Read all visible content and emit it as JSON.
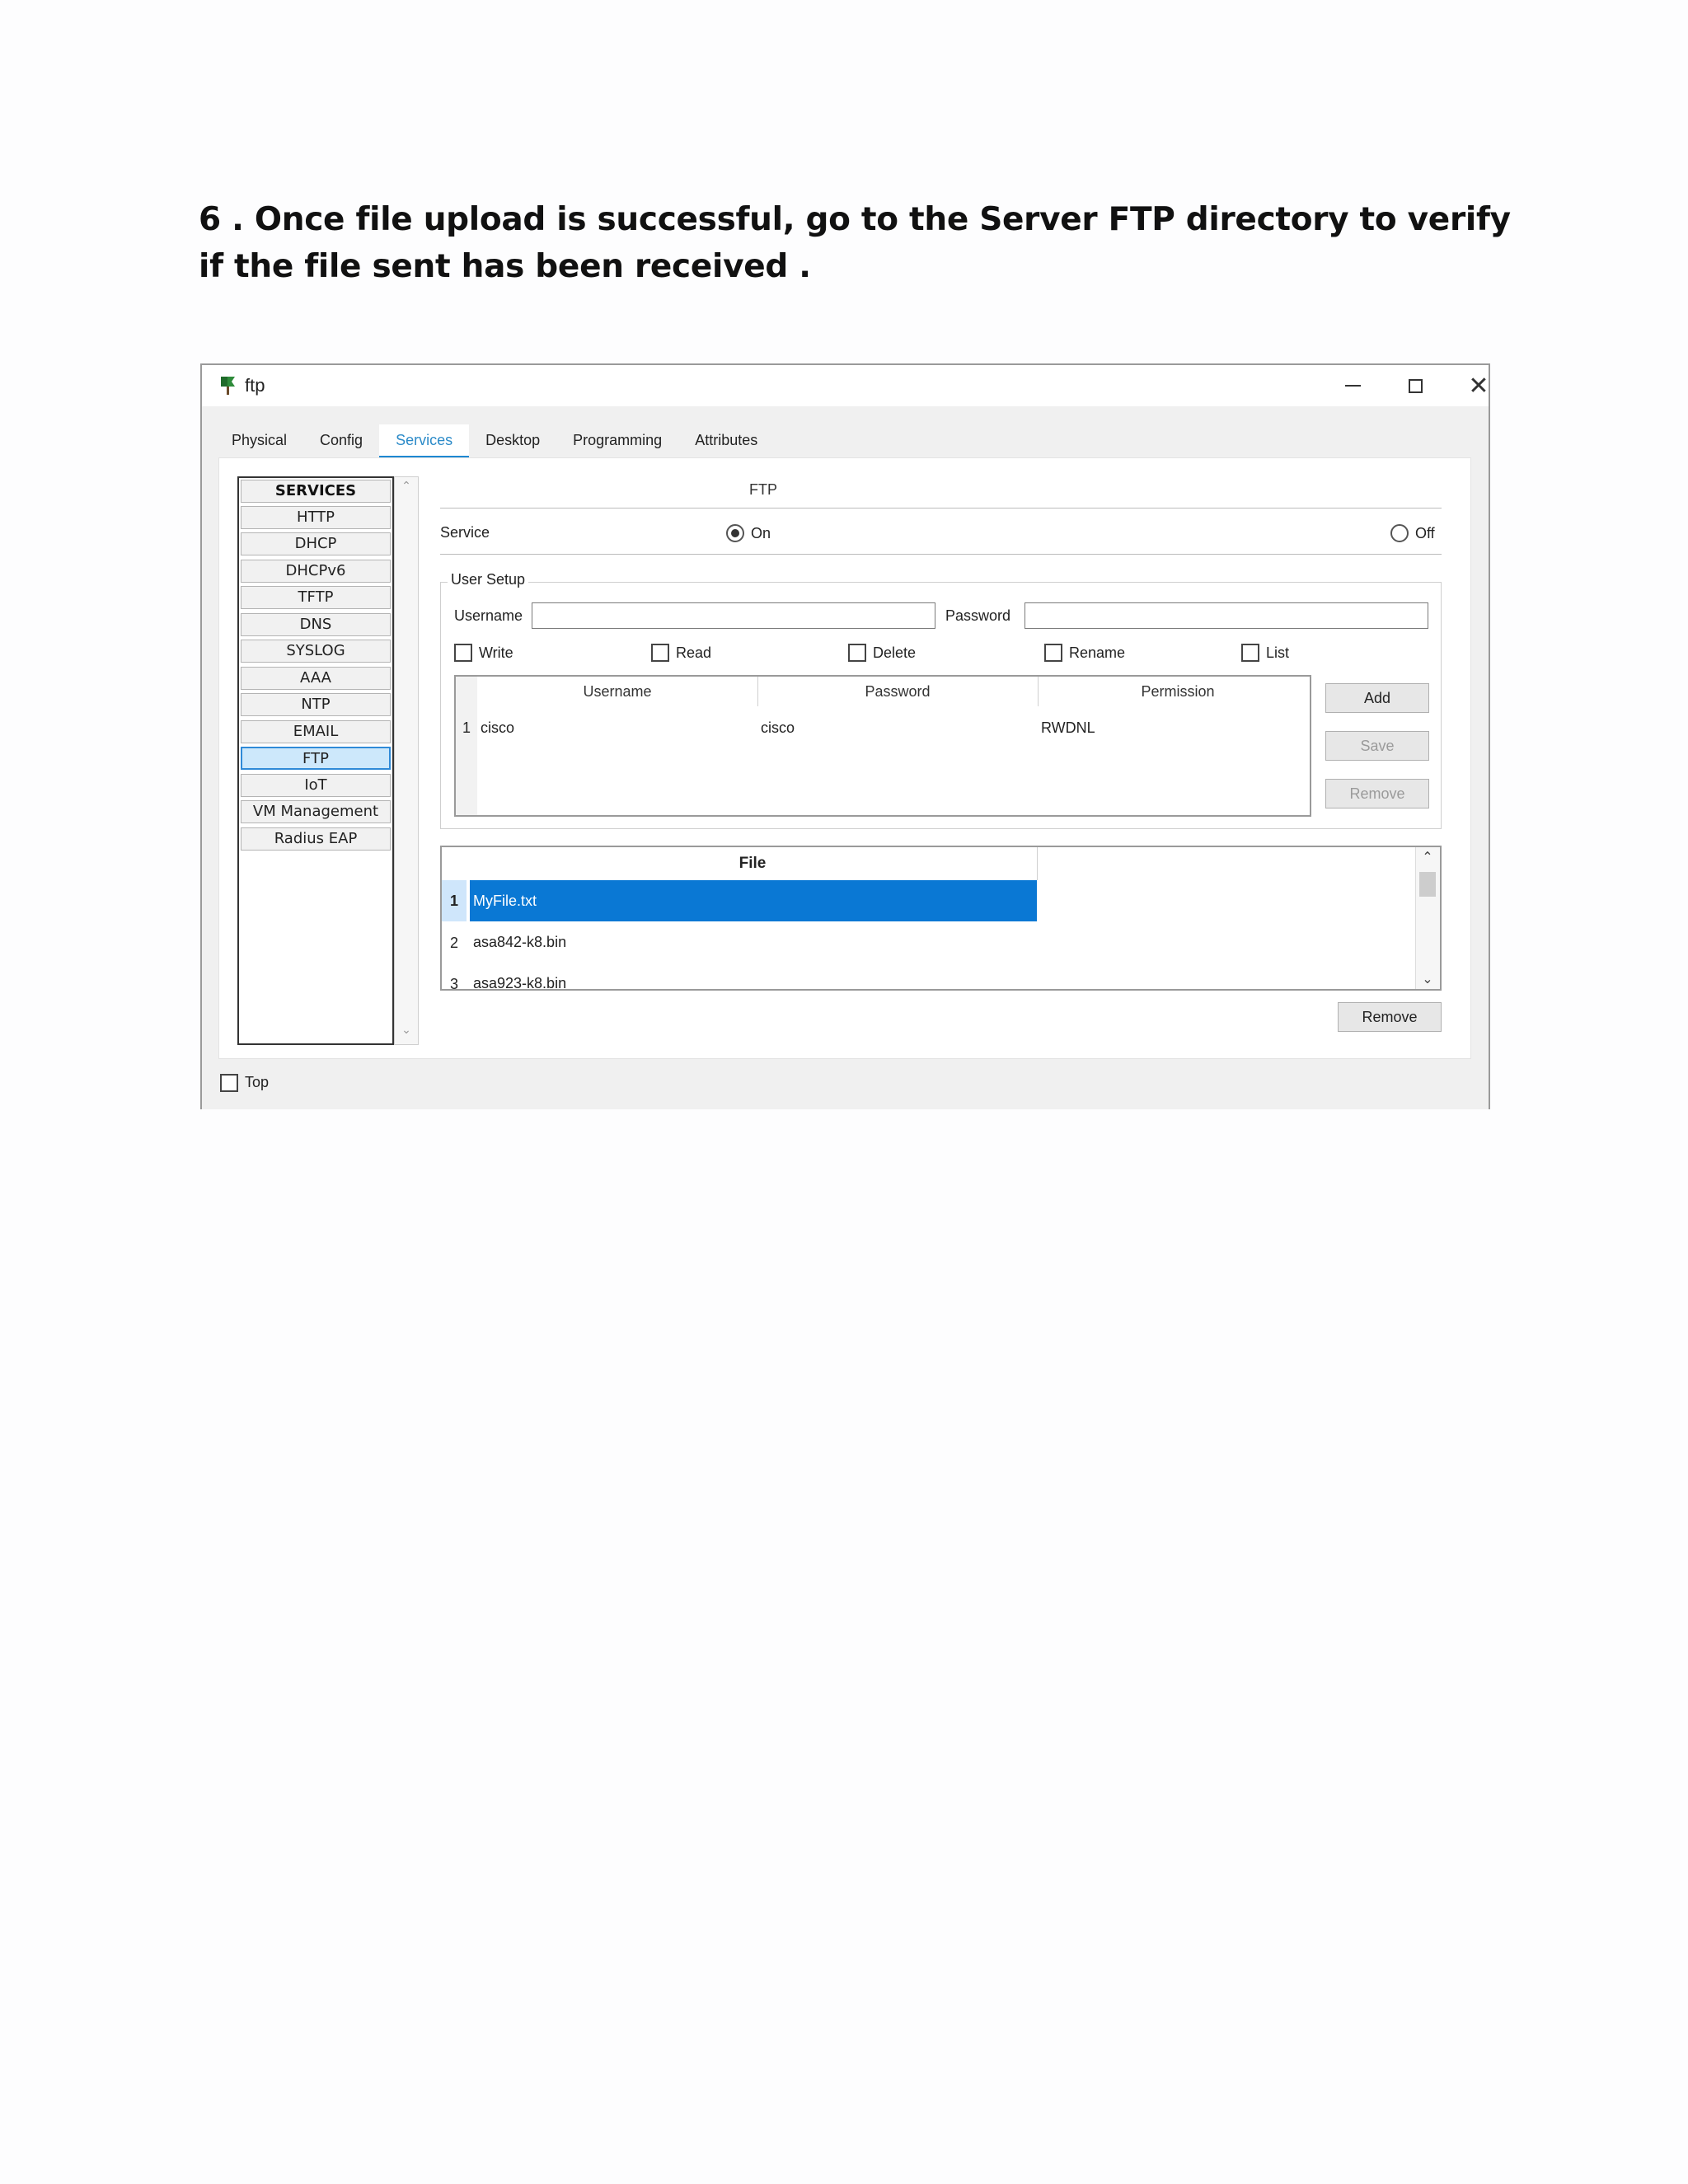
{
  "step_text": "6  . Once file upload is successful, go to the Server FTP directory to verify if the file sent has been received .",
  "window": {
    "title": "ftp",
    "minimize_icon": "minimize-icon",
    "maximize_icon": "maximize-icon",
    "close_icon": "close-icon"
  },
  "tabs": [
    {
      "label": "Physical",
      "active": false
    },
    {
      "label": "Config",
      "active": false
    },
    {
      "label": "Services",
      "active": true
    },
    {
      "label": "Desktop",
      "active": false
    },
    {
      "label": "Programming",
      "active": false
    },
    {
      "label": "Attributes",
      "active": false
    }
  ],
  "services": {
    "header": "SERVICES",
    "items": [
      "HTTP",
      "DHCP",
      "DHCPv6",
      "TFTP",
      "DNS",
      "SYSLOG",
      "AAA",
      "NTP",
      "EMAIL",
      "FTP",
      "IoT",
      "VM Management",
      "Radius EAP"
    ],
    "selected": "FTP"
  },
  "ftp": {
    "title": "FTP",
    "service_label": "Service",
    "on_label": "On",
    "off_label": "Off",
    "service_state": "On",
    "user_setup": {
      "legend": "User Setup",
      "username_label": "Username",
      "username_value": "",
      "password_label": "Password",
      "password_value": "",
      "permissions": [
        "Write",
        "Read",
        "Delete",
        "Rename",
        "List"
      ],
      "columns": [
        "Username",
        "Password",
        "Permission"
      ],
      "rows": [
        {
          "num": "1",
          "username": "cisco",
          "password": "cisco",
          "permission": "RWDNL"
        }
      ],
      "buttons": {
        "add": "Add",
        "save": "Save",
        "remove": "Remove"
      }
    },
    "files": {
      "header": "File",
      "rows": [
        {
          "num": "1",
          "name": "MyFile.txt",
          "selected": true
        },
        {
          "num": "2",
          "name": "asa842-k8.bin",
          "selected": false
        },
        {
          "num": "3",
          "name": "asa923-k8.bin",
          "selected": false
        }
      ],
      "remove_label": "Remove"
    }
  },
  "top_checkbox_label": "Top",
  "colors": {
    "accent": "#0a78d4",
    "selected_service_bg": "#cde8fb",
    "active_tab": "#2b8ac8"
  }
}
